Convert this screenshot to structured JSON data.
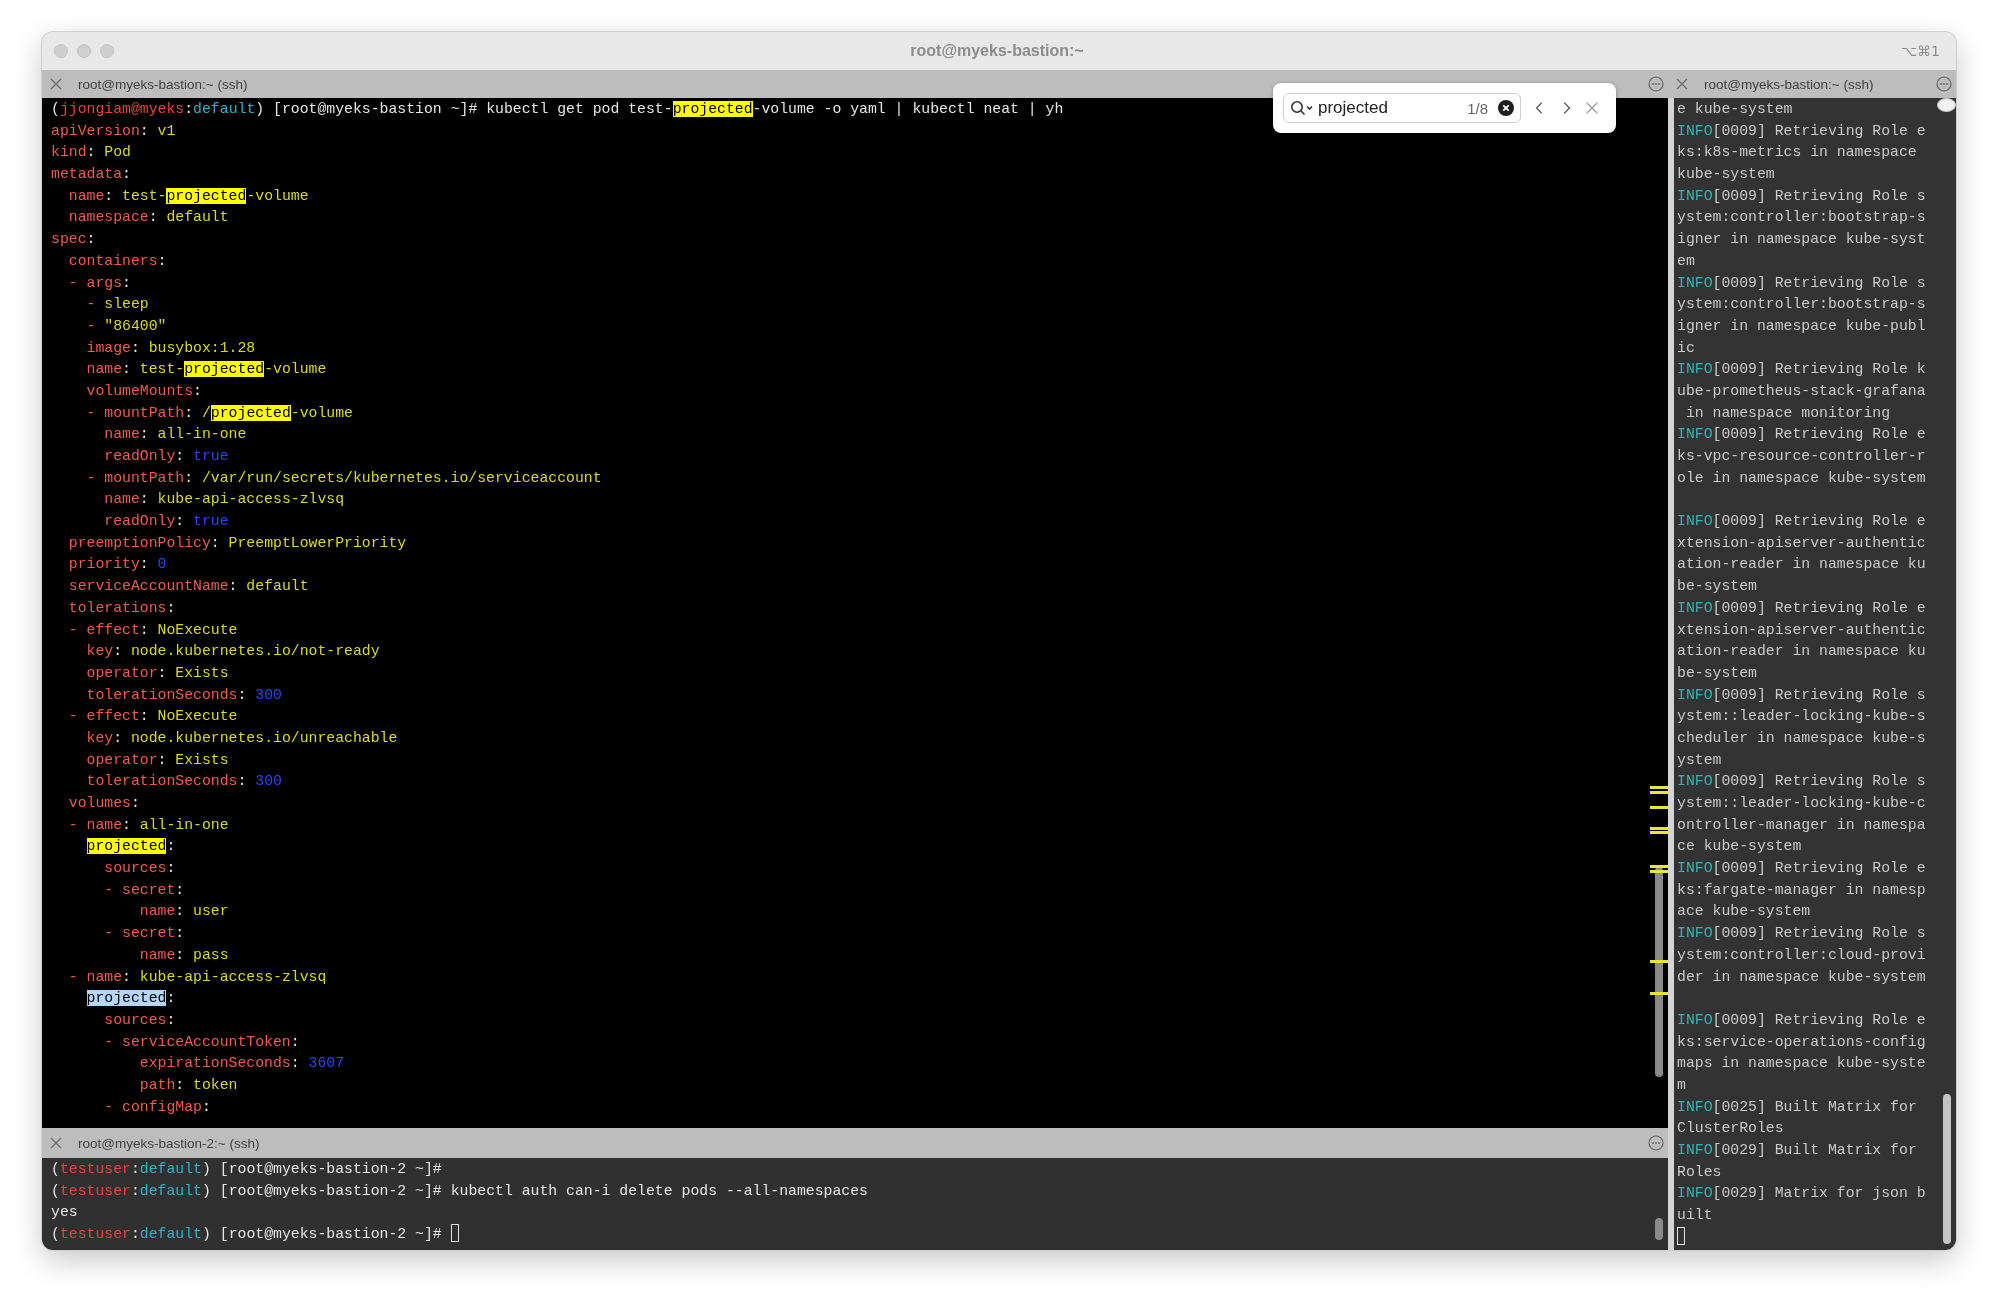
{
  "window": {
    "title": "root@myeks-bastion:~",
    "shortcut": "⌥⌘1"
  },
  "main_pane": {
    "title": "root@myeks-bastion:~ (ssh)",
    "lines": [
      {
        "segs": [
          {
            "kind": "plain",
            "text": "("
          },
          {
            "kind": "user",
            "text": "jjongiam@myeks"
          },
          {
            "kind": "plain",
            "text": ":"
          },
          {
            "kind": "ns",
            "text": "default"
          },
          {
            "kind": "plain",
            "text": ") [root@myeks-bastion ~]# kubectl get pod test-"
          },
          {
            "kind": "match",
            "text": "projected"
          },
          {
            "kind": "plain",
            "text": "-volume -o yaml | kubectl neat | yh"
          }
        ]
      },
      {
        "segs": [
          {
            "kind": "key",
            "text": "apiVersion"
          },
          {
            "kind": "plain",
            "text": ": "
          },
          {
            "kind": "val",
            "text": "v1"
          }
        ]
      },
      {
        "segs": [
          {
            "kind": "key",
            "text": "kind"
          },
          {
            "kind": "plain",
            "text": ": "
          },
          {
            "kind": "val",
            "text": "Pod"
          }
        ]
      },
      {
        "segs": [
          {
            "kind": "key",
            "text": "metadata"
          },
          {
            "kind": "plain",
            "text": ":"
          }
        ]
      },
      {
        "segs": [
          {
            "kind": "key",
            "text": "  name"
          },
          {
            "kind": "plain",
            "text": ": "
          },
          {
            "kind": "val",
            "text": "test-"
          },
          {
            "kind": "match",
            "text": "projected"
          },
          {
            "kind": "val",
            "text": "-volume"
          }
        ]
      },
      {
        "segs": [
          {
            "kind": "key",
            "text": "  namespace"
          },
          {
            "kind": "plain",
            "text": ": "
          },
          {
            "kind": "val",
            "text": "default"
          }
        ]
      },
      {
        "segs": [
          {
            "kind": "key",
            "text": "spec"
          },
          {
            "kind": "plain",
            "text": ":"
          }
        ]
      },
      {
        "segs": [
          {
            "kind": "key",
            "text": "  containers"
          },
          {
            "kind": "plain",
            "text": ":"
          }
        ]
      },
      {
        "segs": [
          {
            "kind": "key",
            "text": "  - args"
          },
          {
            "kind": "plain",
            "text": ":"
          }
        ]
      },
      {
        "segs": [
          {
            "kind": "key",
            "text": "    - "
          },
          {
            "kind": "val",
            "text": "sleep"
          }
        ]
      },
      {
        "segs": [
          {
            "kind": "key",
            "text": "    - "
          },
          {
            "kind": "val",
            "text": "\"86400\""
          }
        ]
      },
      {
        "segs": [
          {
            "kind": "key",
            "text": "    image"
          },
          {
            "kind": "plain",
            "text": ": "
          },
          {
            "kind": "val",
            "text": "busybox:1.28"
          }
        ]
      },
      {
        "segs": [
          {
            "kind": "key",
            "text": "    name"
          },
          {
            "kind": "plain",
            "text": ": "
          },
          {
            "kind": "val",
            "text": "test-"
          },
          {
            "kind": "match",
            "text": "projected"
          },
          {
            "kind": "val",
            "text": "-volume"
          }
        ]
      },
      {
        "segs": [
          {
            "kind": "key",
            "text": "    volumeMounts"
          },
          {
            "kind": "plain",
            "text": ":"
          }
        ]
      },
      {
        "segs": [
          {
            "kind": "key",
            "text": "    - mountPath"
          },
          {
            "kind": "plain",
            "text": ": "
          },
          {
            "kind": "val",
            "text": "/"
          },
          {
            "kind": "match",
            "text": "projected"
          },
          {
            "kind": "val",
            "text": "-volume"
          }
        ]
      },
      {
        "segs": [
          {
            "kind": "key",
            "text": "      name"
          },
          {
            "kind": "plain",
            "text": ": "
          },
          {
            "kind": "val",
            "text": "all-in-one"
          }
        ]
      },
      {
        "segs": [
          {
            "kind": "key",
            "text": "      readOnly"
          },
          {
            "kind": "plain",
            "text": ": "
          },
          {
            "kind": "num",
            "text": "true"
          }
        ]
      },
      {
        "segs": [
          {
            "kind": "key",
            "text": "    - mountPath"
          },
          {
            "kind": "plain",
            "text": ": "
          },
          {
            "kind": "val",
            "text": "/var/run/secrets/kubernetes.io/serviceaccount"
          }
        ]
      },
      {
        "segs": [
          {
            "kind": "key",
            "text": "      name"
          },
          {
            "kind": "plain",
            "text": ": "
          },
          {
            "kind": "val",
            "text": "kube-api-access-zlvsq"
          }
        ]
      },
      {
        "segs": [
          {
            "kind": "key",
            "text": "      readOnly"
          },
          {
            "kind": "plain",
            "text": ": "
          },
          {
            "kind": "num",
            "text": "true"
          }
        ]
      },
      {
        "segs": [
          {
            "kind": "key",
            "text": "  preemptionPolicy"
          },
          {
            "kind": "plain",
            "text": ": "
          },
          {
            "kind": "val",
            "text": "PreemptLowerPriority"
          }
        ]
      },
      {
        "segs": [
          {
            "kind": "key",
            "text": "  priority"
          },
          {
            "kind": "plain",
            "text": ": "
          },
          {
            "kind": "num",
            "text": "0"
          }
        ]
      },
      {
        "segs": [
          {
            "kind": "key",
            "text": "  serviceAccountName"
          },
          {
            "kind": "plain",
            "text": ": "
          },
          {
            "kind": "val",
            "text": "default"
          }
        ]
      },
      {
        "segs": [
          {
            "kind": "key",
            "text": "  tolerations"
          },
          {
            "kind": "plain",
            "text": ":"
          }
        ]
      },
      {
        "segs": [
          {
            "kind": "key",
            "text": "  - effect"
          },
          {
            "kind": "plain",
            "text": ": "
          },
          {
            "kind": "val",
            "text": "NoExecute"
          }
        ]
      },
      {
        "segs": [
          {
            "kind": "key",
            "text": "    key"
          },
          {
            "kind": "plain",
            "text": ": "
          },
          {
            "kind": "val",
            "text": "node.kubernetes.io/not-ready"
          }
        ]
      },
      {
        "segs": [
          {
            "kind": "key",
            "text": "    operator"
          },
          {
            "kind": "plain",
            "text": ": "
          },
          {
            "kind": "val",
            "text": "Exists"
          }
        ]
      },
      {
        "segs": [
          {
            "kind": "key",
            "text": "    tolerationSeconds"
          },
          {
            "kind": "plain",
            "text": ": "
          },
          {
            "kind": "num",
            "text": "300"
          }
        ]
      },
      {
        "segs": [
          {
            "kind": "key",
            "text": "  - effect"
          },
          {
            "kind": "plain",
            "text": ": "
          },
          {
            "kind": "val",
            "text": "NoExecute"
          }
        ]
      },
      {
        "segs": [
          {
            "kind": "key",
            "text": "    key"
          },
          {
            "kind": "plain",
            "text": ": "
          },
          {
            "kind": "val",
            "text": "node.kubernetes.io/unreachable"
          }
        ]
      },
      {
        "segs": [
          {
            "kind": "key",
            "text": "    operator"
          },
          {
            "kind": "plain",
            "text": ": "
          },
          {
            "kind": "val",
            "text": "Exists"
          }
        ]
      },
      {
        "segs": [
          {
            "kind": "key",
            "text": "    tolerationSeconds"
          },
          {
            "kind": "plain",
            "text": ": "
          },
          {
            "kind": "num",
            "text": "300"
          }
        ]
      },
      {
        "segs": [
          {
            "kind": "key",
            "text": "  volumes"
          },
          {
            "kind": "plain",
            "text": ":"
          }
        ]
      },
      {
        "segs": [
          {
            "kind": "key",
            "text": "  - name"
          },
          {
            "kind": "plain",
            "text": ": "
          },
          {
            "kind": "val",
            "text": "all-in-one"
          }
        ]
      },
      {
        "indented": true,
        "segs": [
          {
            "kind": "match",
            "text": "projected"
          },
          {
            "kind": "plain",
            "text": ":"
          }
        ]
      },
      {
        "segs": [
          {
            "kind": "key",
            "text": "      sources"
          },
          {
            "kind": "plain",
            "text": ":"
          }
        ]
      },
      {
        "segs": [
          {
            "kind": "key",
            "text": "      - secret"
          },
          {
            "kind": "plain",
            "text": ":"
          }
        ]
      },
      {
        "segs": [
          {
            "kind": "key",
            "text": "          name"
          },
          {
            "kind": "plain",
            "text": ": "
          },
          {
            "kind": "val",
            "text": "user"
          }
        ]
      },
      {
        "segs": [
          {
            "kind": "key",
            "text": "      - secret"
          },
          {
            "kind": "plain",
            "text": ":"
          }
        ]
      },
      {
        "segs": [
          {
            "kind": "key",
            "text": "          name"
          },
          {
            "kind": "plain",
            "text": ": "
          },
          {
            "kind": "val",
            "text": "pass"
          }
        ]
      },
      {
        "segs": [
          {
            "kind": "key",
            "text": "  - name"
          },
          {
            "kind": "plain",
            "text": ": "
          },
          {
            "kind": "val",
            "text": "kube-api-access-zlvsq"
          }
        ]
      },
      {
        "indented": true,
        "segs": [
          {
            "kind": "current",
            "text": "projected"
          },
          {
            "kind": "plain",
            "text": ":"
          }
        ]
      },
      {
        "segs": [
          {
            "kind": "key",
            "text": "      sources"
          },
          {
            "kind": "plain",
            "text": ":"
          }
        ]
      },
      {
        "segs": [
          {
            "kind": "key",
            "text": "      - serviceAccountToken"
          },
          {
            "kind": "plain",
            "text": ":"
          }
        ]
      },
      {
        "segs": [
          {
            "kind": "key",
            "text": "          expirationSeconds"
          },
          {
            "kind": "plain",
            "text": ": "
          },
          {
            "kind": "num",
            "text": "3607"
          }
        ]
      },
      {
        "segs": [
          {
            "kind": "key",
            "text": "          path"
          },
          {
            "kind": "plain",
            "text": ": "
          },
          {
            "kind": "val",
            "text": "token"
          }
        ]
      },
      {
        "segs": [
          {
            "kind": "key",
            "text": "      - configMap"
          },
          {
            "kind": "plain",
            "text": ":"
          }
        ]
      }
    ]
  },
  "search": {
    "query": "projected",
    "count": "1/8"
  },
  "bottom_pane": {
    "title": "root@myeks-bastion-2:~ (ssh)",
    "lines": [
      {
        "segs": [
          {
            "kind": "plain",
            "text": "("
          },
          {
            "kind": "user",
            "text": "testuser"
          },
          {
            "kind": "plain",
            "text": ":"
          },
          {
            "kind": "ns",
            "text": "default"
          },
          {
            "kind": "plain",
            "text": ") [root@myeks-bastion-2 ~]#"
          }
        ]
      },
      {
        "segs": [
          {
            "kind": "plain",
            "text": "("
          },
          {
            "kind": "user",
            "text": "testuser"
          },
          {
            "kind": "plain",
            "text": ":"
          },
          {
            "kind": "ns",
            "text": "default"
          },
          {
            "kind": "plain",
            "text": ") [root@myeks-bastion-2 ~]# kubectl auth can-i delete pods --all-namespaces"
          }
        ]
      },
      {
        "segs": [
          {
            "kind": "plain",
            "text": "yes"
          }
        ]
      },
      {
        "segs": [
          {
            "kind": "plain",
            "text": "("
          },
          {
            "kind": "user",
            "text": "testuser"
          },
          {
            "kind": "plain",
            "text": ":"
          },
          {
            "kind": "ns",
            "text": "default"
          },
          {
            "kind": "plain",
            "text": ") [root@myeks-bastion-2 ~]# "
          }
        ],
        "cursor": true
      }
    ]
  },
  "side_pane": {
    "title": "root@myeks-bastion:~ (ssh)",
    "lines": [
      {
        "segs": [
          {
            "kind": "plain",
            "text": "e kube-system"
          }
        ]
      },
      {
        "segs": [
          {
            "kind": "info",
            "text": "INFO"
          },
          {
            "kind": "plain",
            "text": "[0009] Retrieving Role e"
          }
        ]
      },
      {
        "segs": [
          {
            "kind": "plain",
            "text": "ks:k8s-metrics in namespace"
          }
        ]
      },
      {
        "segs": [
          {
            "kind": "plain",
            "text": "kube-system"
          }
        ]
      },
      {
        "segs": [
          {
            "kind": "info",
            "text": "INFO"
          },
          {
            "kind": "plain",
            "text": "[0009] Retrieving Role s"
          }
        ]
      },
      {
        "segs": [
          {
            "kind": "plain",
            "text": "ystem:controller:bootstrap-s"
          }
        ]
      },
      {
        "segs": [
          {
            "kind": "plain",
            "text": "igner in namespace kube-syst"
          }
        ]
      },
      {
        "segs": [
          {
            "kind": "plain",
            "text": "em"
          }
        ]
      },
      {
        "segs": [
          {
            "kind": "info",
            "text": "INFO"
          },
          {
            "kind": "plain",
            "text": "[0009] Retrieving Role s"
          }
        ]
      },
      {
        "segs": [
          {
            "kind": "plain",
            "text": "ystem:controller:bootstrap-s"
          }
        ]
      },
      {
        "segs": [
          {
            "kind": "plain",
            "text": "igner in namespace kube-publ"
          }
        ]
      },
      {
        "segs": [
          {
            "kind": "plain",
            "text": "ic"
          }
        ]
      },
      {
        "segs": [
          {
            "kind": "info",
            "text": "INFO"
          },
          {
            "kind": "plain",
            "text": "[0009] Retrieving Role k"
          }
        ]
      },
      {
        "segs": [
          {
            "kind": "plain",
            "text": "ube-prometheus-stack-grafana"
          }
        ]
      },
      {
        "segs": [
          {
            "kind": "plain",
            "text": " in namespace monitoring"
          }
        ]
      },
      {
        "segs": [
          {
            "kind": "info",
            "text": "INFO"
          },
          {
            "kind": "plain",
            "text": "[0009] Retrieving Role e"
          }
        ]
      },
      {
        "segs": [
          {
            "kind": "plain",
            "text": "ks-vpc-resource-controller-r"
          }
        ]
      },
      {
        "segs": [
          {
            "kind": "plain",
            "text": "ole in namespace kube-system"
          }
        ]
      },
      {
        "segs": [
          {
            "kind": "info",
            "text": "INFO"
          },
          {
            "kind": "plain",
            "text": "[0009] Retrieving Role e"
          }
        ],
        "gap_before": true
      },
      {
        "segs": [
          {
            "kind": "plain",
            "text": "xtension-apiserver-authentic"
          }
        ]
      },
      {
        "segs": [
          {
            "kind": "plain",
            "text": "ation-reader in namespace ku"
          }
        ]
      },
      {
        "segs": [
          {
            "kind": "plain",
            "text": "be-system"
          }
        ]
      },
      {
        "segs": [
          {
            "kind": "info",
            "text": "INFO"
          },
          {
            "kind": "plain",
            "text": "[0009] Retrieving Role e"
          }
        ]
      },
      {
        "segs": [
          {
            "kind": "plain",
            "text": "xtension-apiserver-authentic"
          }
        ]
      },
      {
        "segs": [
          {
            "kind": "plain",
            "text": "ation-reader in namespace ku"
          }
        ]
      },
      {
        "segs": [
          {
            "kind": "plain",
            "text": "be-system"
          }
        ]
      },
      {
        "segs": [
          {
            "kind": "info",
            "text": "INFO"
          },
          {
            "kind": "plain",
            "text": "[0009] Retrieving Role s"
          }
        ]
      },
      {
        "segs": [
          {
            "kind": "plain",
            "text": "ystem::leader-locking-kube-s"
          }
        ]
      },
      {
        "segs": [
          {
            "kind": "plain",
            "text": "cheduler in namespace kube-s"
          }
        ]
      },
      {
        "segs": [
          {
            "kind": "plain",
            "text": "ystem"
          }
        ]
      },
      {
        "segs": [
          {
            "kind": "info",
            "text": "INFO"
          },
          {
            "kind": "plain",
            "text": "[0009] Retrieving Role s"
          }
        ]
      },
      {
        "segs": [
          {
            "kind": "plain",
            "text": "ystem::leader-locking-kube-c"
          }
        ]
      },
      {
        "segs": [
          {
            "kind": "plain",
            "text": "ontroller-manager in namespa"
          }
        ]
      },
      {
        "segs": [
          {
            "kind": "plain",
            "text": "ce kube-system"
          }
        ]
      },
      {
        "segs": [
          {
            "kind": "info",
            "text": "INFO"
          },
          {
            "kind": "plain",
            "text": "[0009] Retrieving Role e"
          }
        ]
      },
      {
        "segs": [
          {
            "kind": "plain",
            "text": "ks:fargate-manager in namesp"
          }
        ]
      },
      {
        "segs": [
          {
            "kind": "plain",
            "text": "ace kube-system"
          }
        ]
      },
      {
        "segs": [
          {
            "kind": "info",
            "text": "INFO"
          },
          {
            "kind": "plain",
            "text": "[0009] Retrieving Role s"
          }
        ]
      },
      {
        "segs": [
          {
            "kind": "plain",
            "text": "ystem:controller:cloud-provi"
          }
        ]
      },
      {
        "segs": [
          {
            "kind": "plain",
            "text": "der in namespace kube-system"
          }
        ]
      },
      {
        "segs": [
          {
            "kind": "info",
            "text": "INFO"
          },
          {
            "kind": "plain",
            "text": "[0009] Retrieving Role e"
          }
        ],
        "gap_before": true
      },
      {
        "segs": [
          {
            "kind": "plain",
            "text": "ks:service-operations-config"
          }
        ]
      },
      {
        "segs": [
          {
            "kind": "plain",
            "text": "maps in namespace kube-syste"
          }
        ]
      },
      {
        "segs": [
          {
            "kind": "plain",
            "text": "m"
          }
        ]
      },
      {
        "segs": [
          {
            "kind": "info",
            "text": "INFO"
          },
          {
            "kind": "plain",
            "text": "[0025] Built Matrix for"
          }
        ]
      },
      {
        "segs": [
          {
            "kind": "plain",
            "text": "ClusterRoles"
          }
        ]
      },
      {
        "segs": [
          {
            "kind": "info",
            "text": "INFO"
          },
          {
            "kind": "plain",
            "text": "[0029] Built Matrix for"
          }
        ]
      },
      {
        "segs": [
          {
            "kind": "plain",
            "text": "Roles"
          }
        ]
      },
      {
        "segs": [
          {
            "kind": "info",
            "text": "INFO"
          },
          {
            "kind": "plain",
            "text": "[0029] Matrix for json b"
          }
        ]
      },
      {
        "segs": [
          {
            "kind": "plain",
            "text": "uilt"
          }
        ]
      },
      {
        "cursor": true
      }
    ]
  }
}
